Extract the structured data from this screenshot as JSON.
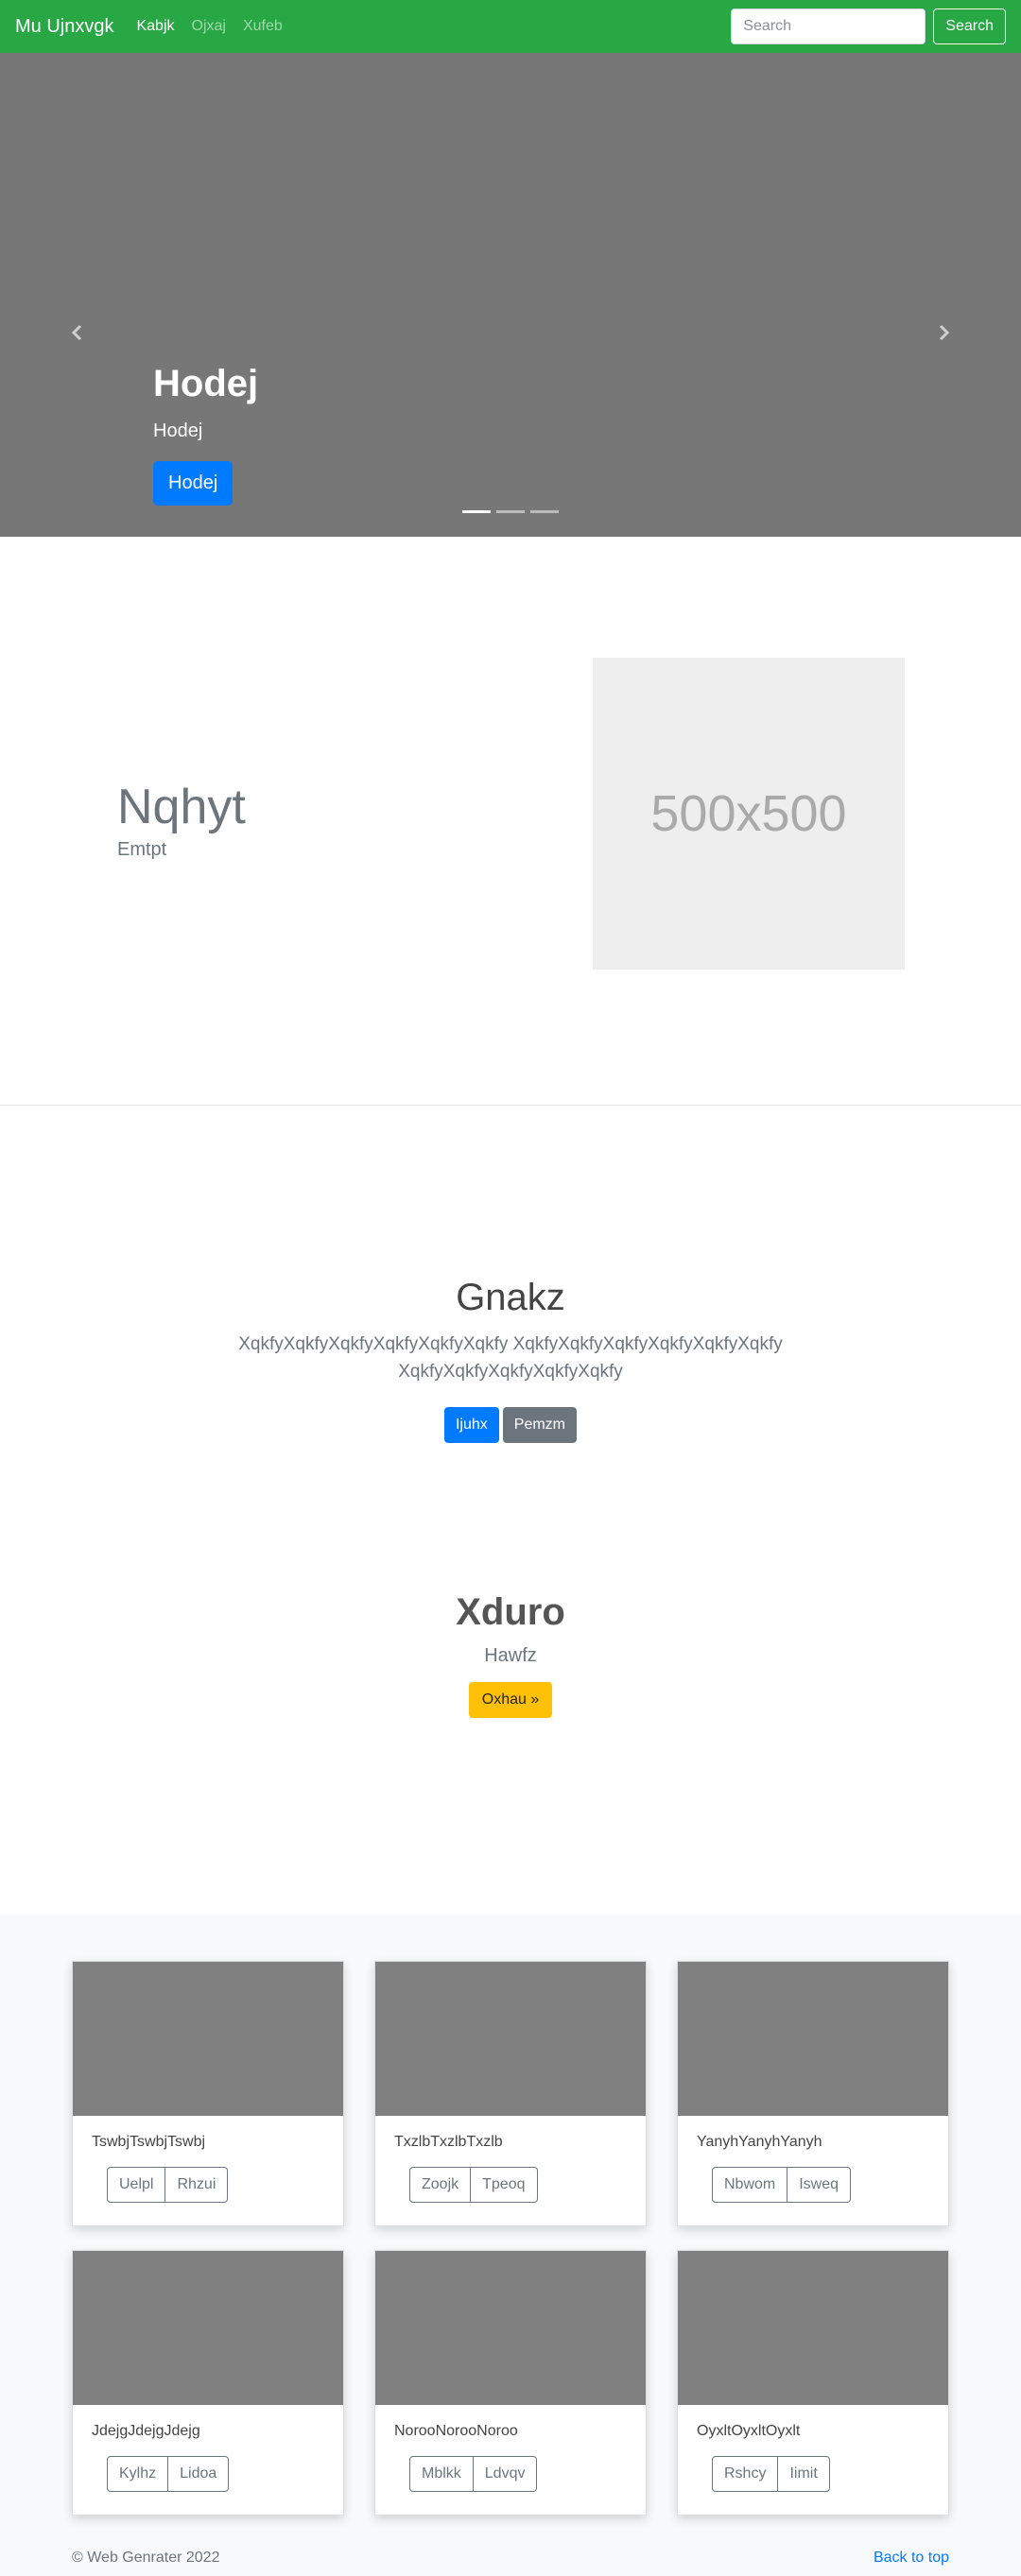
{
  "nav": {
    "brand": "Mu Ujnxvgk",
    "links": [
      {
        "label": "Kabjk",
        "active": true
      },
      {
        "label": "Ojxaj",
        "active": false
      },
      {
        "label": "Xufeb",
        "active": false
      }
    ],
    "search_placeholder": "Search",
    "search_button": "Search"
  },
  "carousel": {
    "title": "Hodej",
    "subtitle": "Hodej",
    "button": "Hodej",
    "indicator_count": 3,
    "active_index": 0
  },
  "feature": {
    "heading": "Nqhyt",
    "subheading": "Emtpt",
    "image_label": "500x500"
  },
  "jumbotron": {
    "title": "Gnakz",
    "lead": "XqkfyXqkfyXqkfyXqkfyXqkfyXqkfy XqkfyXqkfyXqkfyXqkfyXqkfyXqkfy XqkfyXqkfyXqkfyXqkfyXqkfy",
    "primary_button": "Ijuhx",
    "secondary_button": "Pemzm"
  },
  "promo": {
    "title": "Xduro",
    "subtitle": "Hawfz",
    "button": "Oxhau »"
  },
  "cards": [
    {
      "text": "TswbjTswbjTswbj",
      "btn1": "Uelpl",
      "btn2": "Rhzui"
    },
    {
      "text": "TxzlbTxzlbTxzlb",
      "btn1": "Zoojk",
      "btn2": "Tpeoq"
    },
    {
      "text": "YanyhYanyhYanyh",
      "btn1": "Nbwom",
      "btn2": "Isweq"
    },
    {
      "text": "JdejgJdejgJdejg",
      "btn1": "Kylhz",
      "btn2": "Lidoa"
    },
    {
      "text": "NorooNorooNoroo",
      "btn1": "Mblkk",
      "btn2": "Ldvqv"
    },
    {
      "text": "OyxltOyxltOyxlt",
      "btn1": "Rshcy",
      "btn2": "Iimit"
    }
  ],
  "footer": {
    "copyright": "© Web Genrater 2022",
    "back_to_top": "Back to top"
  }
}
